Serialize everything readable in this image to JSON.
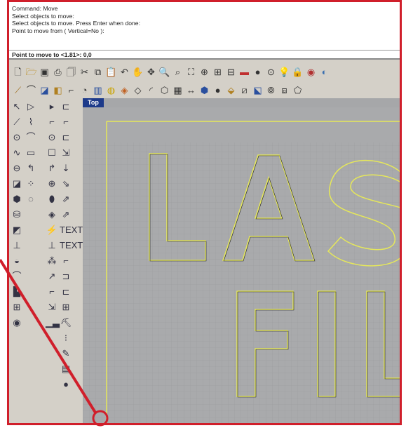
{
  "command_history": {
    "line1": "Command: Move",
    "line2": "Select objects to move:",
    "line3": "Select objects to move. Press Enter when done:",
    "line4": "Point to move from ( Vertical=No ):",
    "prompt": "Point to move to <1.81>: 0,0"
  },
  "viewport": {
    "tab_label": "Top",
    "text_line1": "LAS",
    "text_line2": "FIL"
  },
  "colors": {
    "accent_red": "#d01f2b",
    "viewport_tab": "#1d3a8a",
    "curve_outline": "#e6e85a"
  },
  "toolbar_top": [
    "new-icon",
    "open-icon",
    "save-icon",
    "print-icon",
    "template-icon",
    "cut-icon",
    "copy-icon",
    "paste-icon",
    "undo-icon",
    "pan-icon",
    "rotate-view-icon",
    "zoom-window-icon",
    "zoom-icon",
    "zoom-extents-icon",
    "zoom-selected-icon",
    "grid-snap-icon",
    "four-views-icon",
    "layer-icon",
    "point-icon",
    "osnap-icon",
    "light-icon",
    "lock-icon",
    "render-icon",
    "material-icon"
  ],
  "toolbar_second": [
    "curve-icon",
    "arc-icon",
    "polyline-icon",
    "solid-box-icon",
    "surface-icon",
    "sphere-icon",
    "extrude-icon",
    "revolve-icon",
    "loft-icon",
    "sweep-icon",
    "fillet-icon",
    "boolean-icon",
    "mesh-icon",
    "dimension-icon",
    "text-icon",
    "hatch-icon",
    "project-icon",
    "split-icon",
    "trim-icon",
    "join-icon",
    "explode-icon",
    "group-icon"
  ]
}
